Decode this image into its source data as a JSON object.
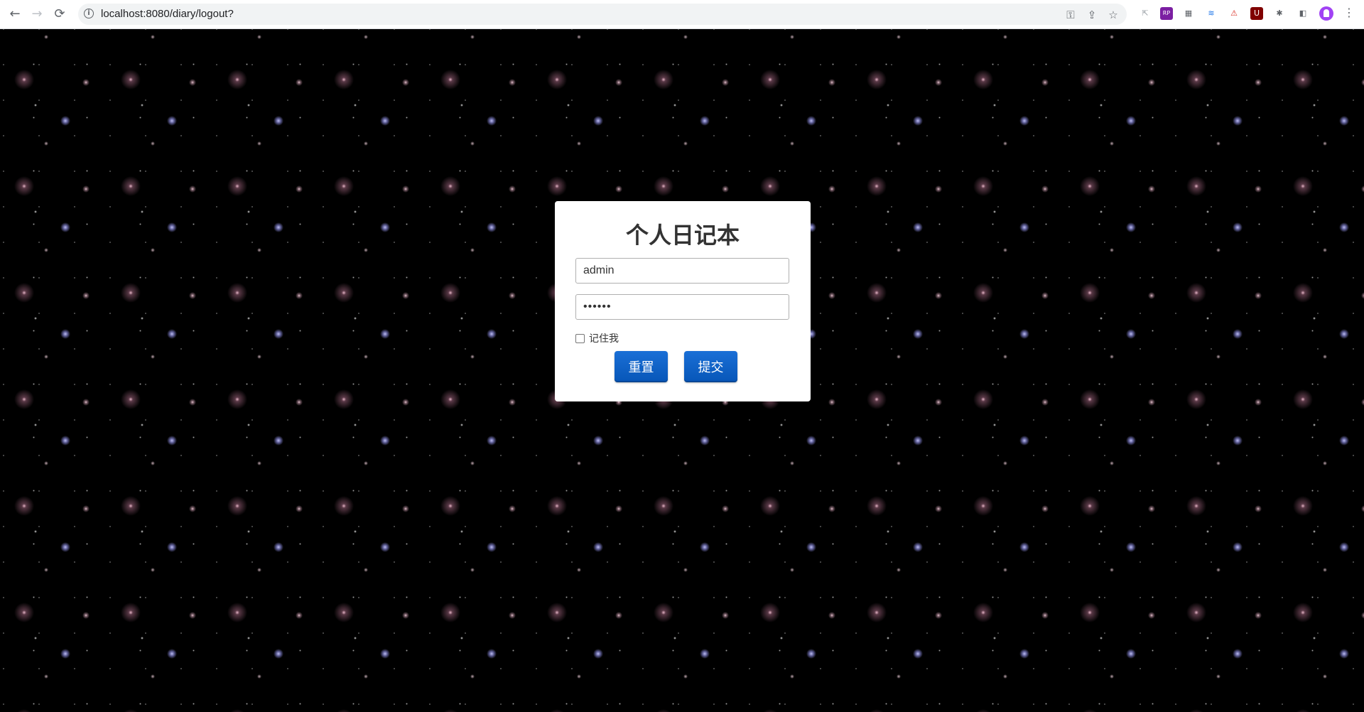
{
  "browser": {
    "url": "localhost:8080/diary/logout?",
    "back_icon": "←",
    "forward_icon": "→",
    "reload_icon": "⟳",
    "info_icon": "i",
    "key_icon": "⚿",
    "share_icon": "⇪",
    "star_icon": "☆",
    "extensions": [
      {
        "name": "cursor-ext-icon",
        "glyph": "⇱",
        "color": "#9aa0a6",
        "bg": "transparent"
      },
      {
        "name": "rp-ext-icon",
        "glyph": "RP",
        "color": "#ffffff",
        "bg": "#7b1fa2"
      },
      {
        "name": "table-ext-icon",
        "glyph": "▦",
        "color": "#5f6368",
        "bg": "transparent"
      },
      {
        "name": "layers-ext-icon",
        "glyph": "≋",
        "color": "#1a73e8",
        "bg": "transparent"
      },
      {
        "name": "alert-ext-icon",
        "glyph": "⚠",
        "color": "#d93025",
        "bg": "transparent"
      },
      {
        "name": "ublock-ext-icon",
        "glyph": "U",
        "color": "#ffffff",
        "bg": "#800000"
      },
      {
        "name": "puzzle-icon",
        "glyph": "✱",
        "color": "#5f6368",
        "bg": "transparent"
      },
      {
        "name": "sidepanel-icon",
        "glyph": "◧",
        "color": "#5f6368",
        "bg": "transparent"
      }
    ],
    "menu_icon": "⋮"
  },
  "login": {
    "title": "个人日记本",
    "username_value": "admin",
    "password_value": "••••••",
    "remember_label": "记住我",
    "reset_label": "重置",
    "submit_label": "提交"
  }
}
